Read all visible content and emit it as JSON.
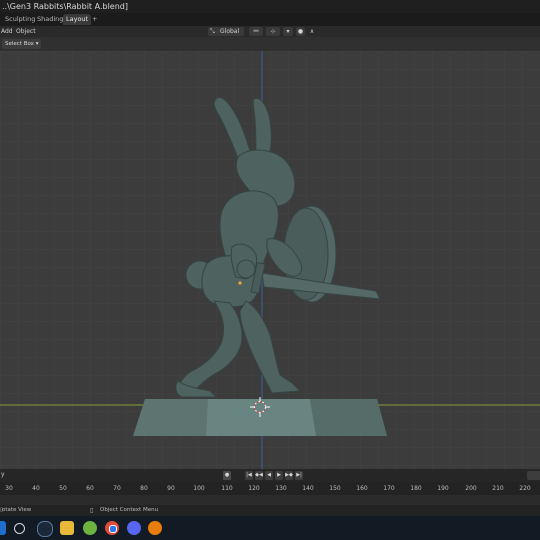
{
  "window": {
    "title": "..\\Gen3 Rabbits\\Rabbit A.blend]"
  },
  "tabs": [
    {
      "label": "Sculpting"
    },
    {
      "label": "Shading"
    },
    {
      "label": "Layout"
    },
    {
      "label": "+"
    }
  ],
  "header": {
    "menu": {
      "add": "Add",
      "object": "Object"
    },
    "orientation": "Global"
  },
  "tool": {
    "select_box": "Select Box"
  },
  "timeline": {
    "left_label": "y",
    "frames": [
      "30",
      "40",
      "50",
      "60",
      "70",
      "80",
      "90",
      "100",
      "110",
      "120",
      "130",
      "140",
      "150",
      "160",
      "170",
      "180",
      "190",
      "200",
      "210",
      "220"
    ]
  },
  "status": {
    "rotate_view": "otate View",
    "context_menu": "Object Context Menu"
  },
  "colors": {
    "viewport_bg": "#3c3c3c",
    "grid_line": "#434343",
    "x_axis": "#7a8a36",
    "y_axis": "#3d5a8c",
    "model": "#4e6260",
    "base": "#5d7470"
  },
  "icons": {
    "playback": [
      "jump-start-icon",
      "prev-keyframe-icon",
      "play-reverse-icon",
      "play-icon",
      "next-keyframe-icon",
      "jump-end-icon"
    ],
    "taskbar": [
      "windows-icon",
      "search-icon",
      "steam-icon",
      "file-explorer-icon",
      "app-green-icon",
      "chrome-icon",
      "discord-icon",
      "blender-icon"
    ]
  }
}
